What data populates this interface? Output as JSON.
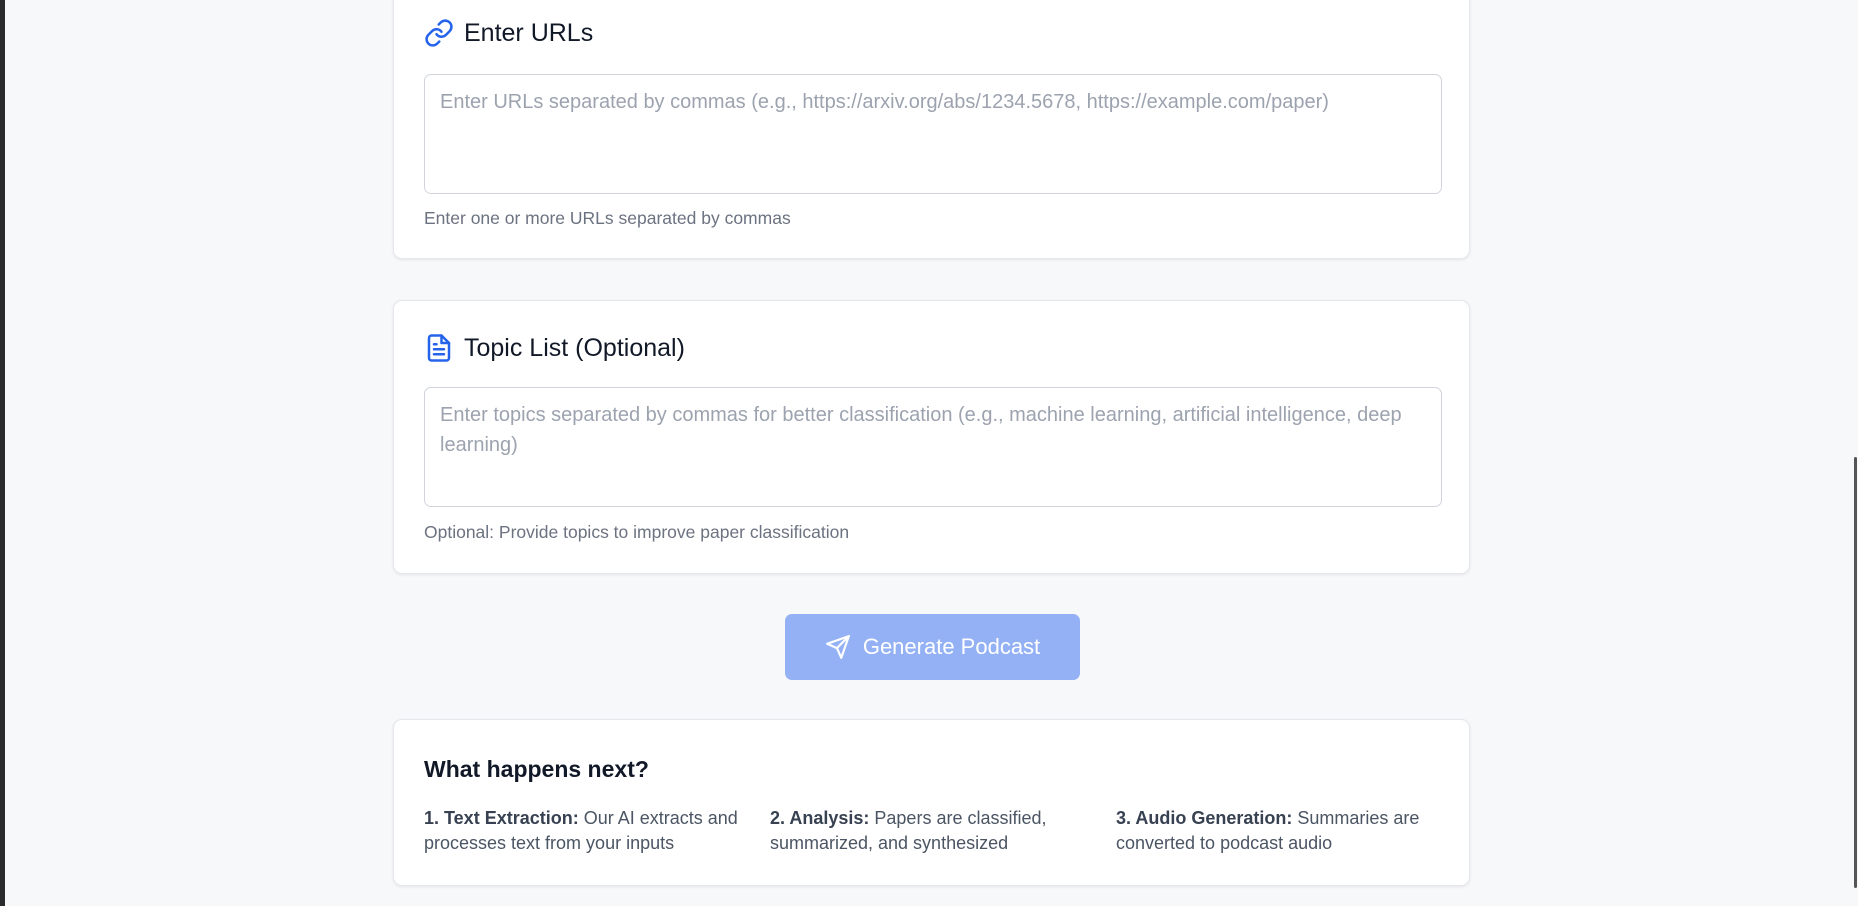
{
  "urls_section": {
    "title": "Enter URLs",
    "icon": "link-icon",
    "placeholder": "Enter URLs separated by commas (e.g., https://arxiv.org/abs/1234.5678, https://example.com/paper)",
    "value": "",
    "hint": "Enter one or more URLs separated by commas"
  },
  "topics_section": {
    "title": "Topic List (Optional)",
    "icon": "document-icon",
    "placeholder": "Enter topics separated by commas for better classification (e.g., machine learning, artificial intelligence, deep learning)",
    "value": "",
    "hint": "Optional: Provide topics to improve paper classification"
  },
  "generate_button": {
    "label": "Generate Podcast",
    "icon": "send-icon",
    "disabled": true
  },
  "next_steps": {
    "title": "What happens next?",
    "steps": [
      {
        "heading": "1. Text Extraction:",
        "text": "Our AI extracts and processes text from your inputs"
      },
      {
        "heading": "2. Analysis:",
        "text": "Papers are classified, summarized, and synthesized"
      },
      {
        "heading": "3. Audio Generation:",
        "text": "Summaries are converted to podcast audio"
      }
    ]
  },
  "colors": {
    "accent": "#2563eb",
    "button_disabled": "#93b1f4",
    "page_background": "#f7f8fa"
  }
}
